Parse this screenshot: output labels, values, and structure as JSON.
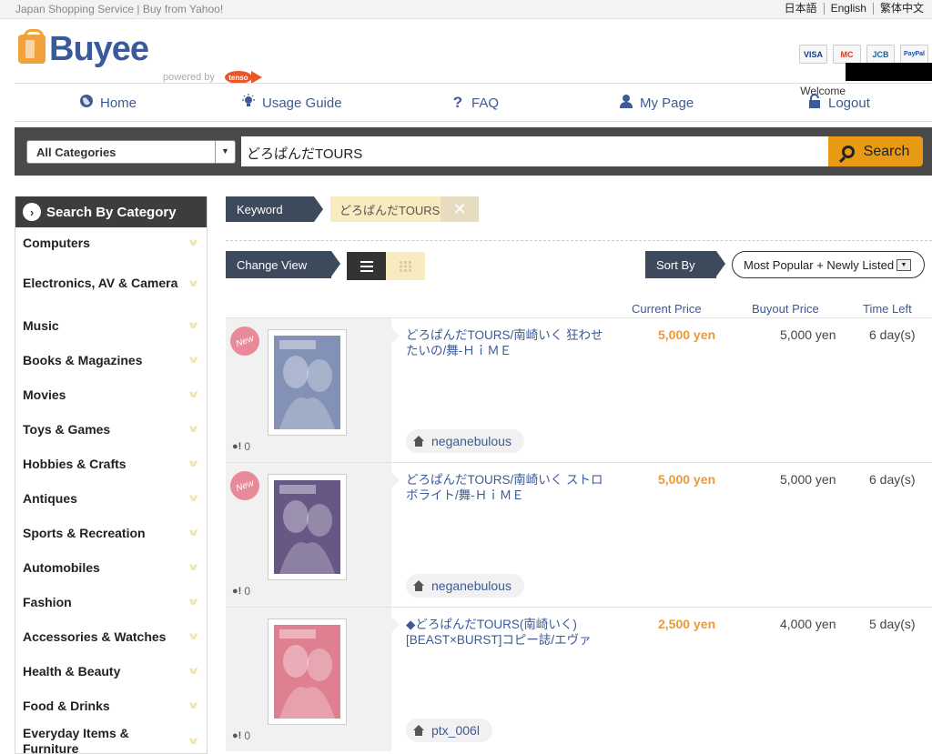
{
  "topbar": {
    "tagline": "Japan Shopping Service | Buy from Yahoo!",
    "languages": [
      "日本語",
      "English",
      "繁体中文"
    ]
  },
  "header": {
    "logo": "Buyee",
    "powered_by": "powered by",
    "partner": "tenso",
    "cards": [
      "VISA",
      "MC",
      "JCB",
      "PayPal"
    ],
    "welcome": "Welcome"
  },
  "nav": {
    "items": [
      {
        "label": "Home",
        "icon": "globe-icon"
      },
      {
        "label": "Usage Guide",
        "icon": "lightbulb-icon"
      },
      {
        "label": "FAQ",
        "icon": "question-icon"
      },
      {
        "label": "My Page",
        "icon": "user-icon"
      },
      {
        "label": "Logout",
        "icon": "lock-icon"
      }
    ]
  },
  "search": {
    "category": "All Categories",
    "keyword": "どろぱんだTOURS",
    "button": "Search"
  },
  "sidebar": {
    "title": "Search By Category",
    "categories": [
      "Computers",
      "Electronics, AV & Camera",
      "Music",
      "Books & Magazines",
      "Movies",
      "Toys & Games",
      "Hobbies & Crafts",
      "Antiques",
      "Sports & Recreation",
      "Automobiles",
      "Fashion",
      "Accessories & Watches",
      "Health & Beauty",
      "Food & Drinks",
      "Everyday Items & Furniture"
    ]
  },
  "filters": {
    "keyword_label": "Keyword",
    "keyword_value": "どろぱんだTOURS",
    "change_view": "Change View",
    "sort_by": "Sort By",
    "sort_value": "Most Popular + Newly Listed"
  },
  "columns": {
    "current_price": "Current Price",
    "buyout_price": "Buyout Price",
    "time_left": "Time Left"
  },
  "items": [
    {
      "badge": "New",
      "title": "どろぱんだTOURS/南崎いく 狂わせたいの/舞-ＨｉＭＥ",
      "current_price": "5,000 yen",
      "buyout_price": "5,000 yen",
      "time_left": "6 day(s)",
      "seller": "neganebulous",
      "watch_count": "0",
      "color": "#6c7ea8"
    },
    {
      "badge": "New",
      "title": "どろぱんだTOURS/南崎いく ストロボライト/舞-ＨｉＭＥ",
      "current_price": "5,000 yen",
      "buyout_price": "5,000 yen",
      "time_left": "6 day(s)",
      "seller": "neganebulous",
      "watch_count": "0",
      "color": "#4b3a6e"
    },
    {
      "badge": "",
      "title": "◆どろぱんだTOURS(南崎いく) [BEAST×BURST]コピー誌/エヴァ",
      "current_price": "2,500 yen",
      "buyout_price": "4,000 yen",
      "time_left": "5 day(s)",
      "seller": "ptx_006l",
      "watch_count": "0",
      "color": "#d96a7e"
    }
  ],
  "colors": {
    "accent": "#e89a14",
    "link": "#3c5a96",
    "price": "#e89a3c",
    "dark": "#3d3d3d"
  }
}
